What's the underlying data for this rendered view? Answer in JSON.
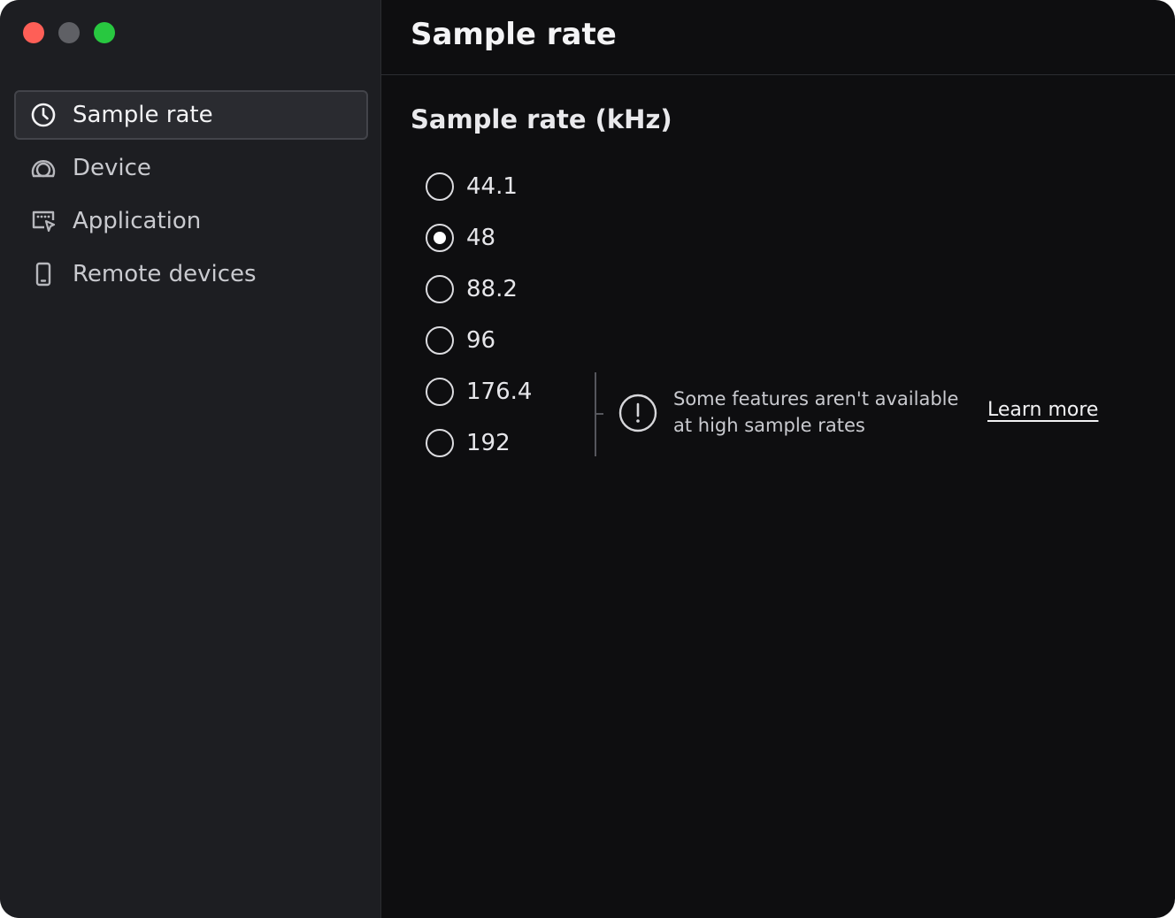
{
  "window": {
    "controls": [
      {
        "name": "close",
        "color": "#fe5f57"
      },
      {
        "name": "minimize",
        "color": "#5f6065"
      },
      {
        "name": "zoom",
        "color": "#28c840"
      }
    ]
  },
  "sidebar": {
    "items": [
      {
        "label": "Sample rate",
        "icon": "clock-icon",
        "active": true
      },
      {
        "label": "Device",
        "icon": "speaker-icon",
        "active": false
      },
      {
        "label": "Application",
        "icon": "app-window-icon",
        "active": false
      },
      {
        "label": "Remote devices",
        "icon": "phone-icon",
        "active": false
      }
    ]
  },
  "main": {
    "title": "Sample rate",
    "section_title": "Sample rate (kHz)",
    "options": [
      {
        "label": "44.1",
        "checked": false
      },
      {
        "label": "48",
        "checked": true
      },
      {
        "label": "88.2",
        "checked": false
      },
      {
        "label": "96",
        "checked": false
      },
      {
        "label": "176.4",
        "checked": false
      },
      {
        "label": "192",
        "checked": false
      }
    ],
    "info": {
      "icon": "exclamation-circle-icon",
      "text": "Some features aren't available at high sample rates",
      "link": "Learn more"
    }
  }
}
